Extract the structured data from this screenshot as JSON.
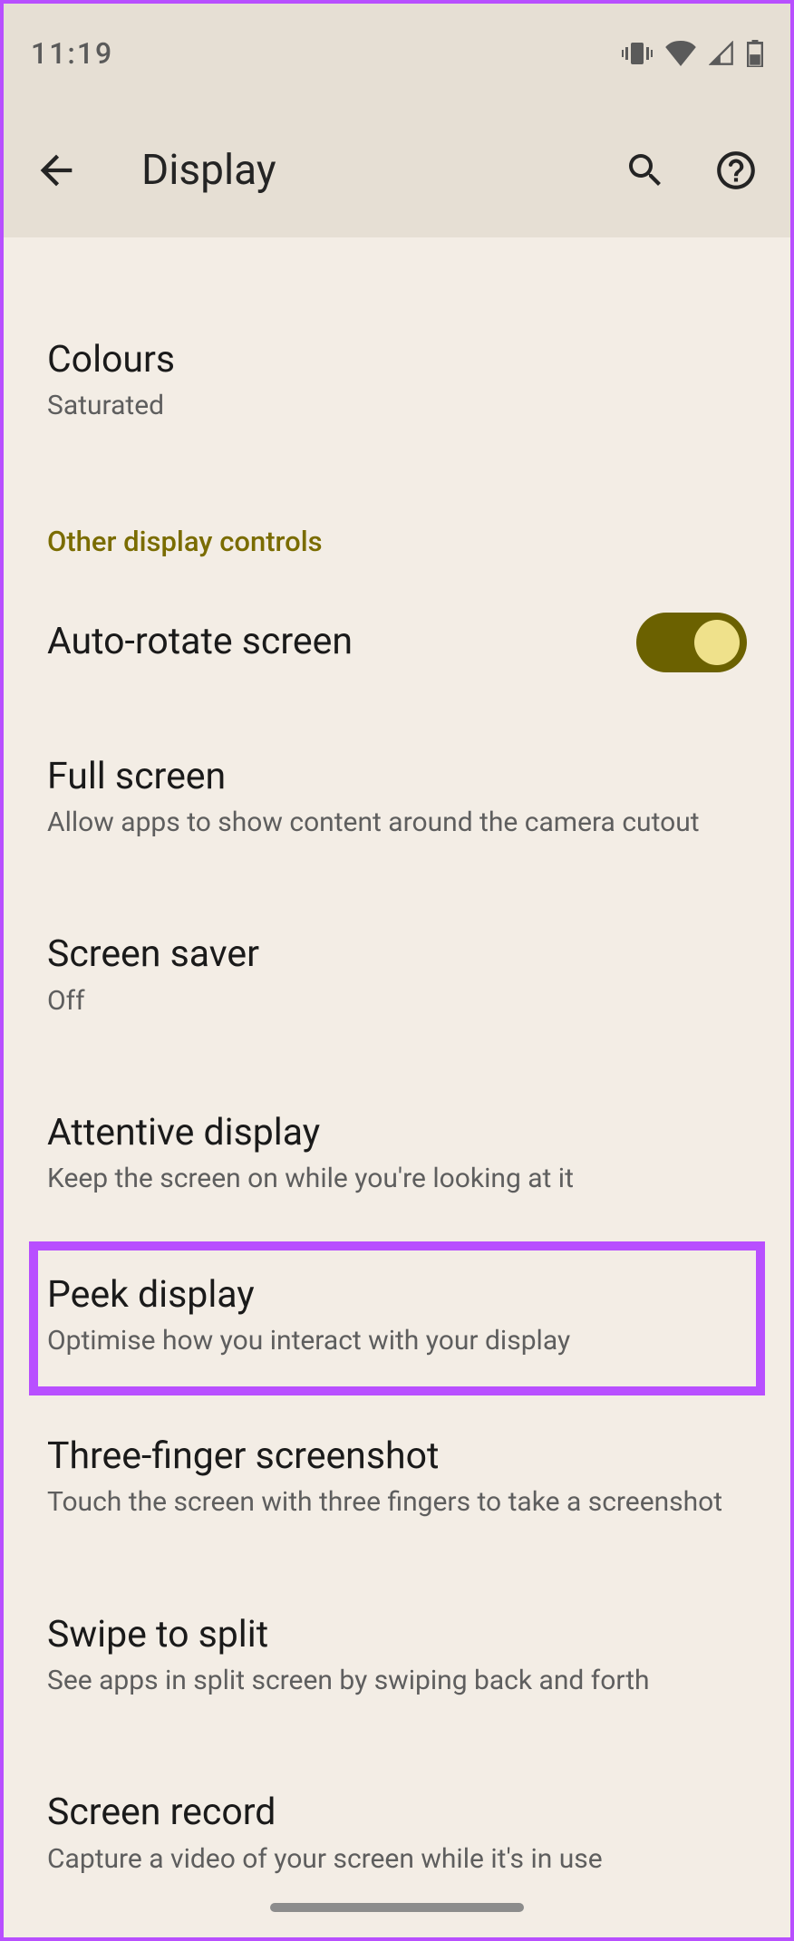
{
  "status": {
    "time": "11:19"
  },
  "appbar": {
    "title": "Display"
  },
  "section_header": "Other display controls",
  "settings": {
    "colours": {
      "title": "Colours",
      "subtitle": "Saturated"
    },
    "auto_rotate": {
      "title": "Auto-rotate screen",
      "enabled": true
    },
    "full_screen": {
      "title": "Full screen",
      "subtitle": "Allow apps to show content around the camera cutout"
    },
    "screen_saver": {
      "title": "Screen saver",
      "subtitle": "Off"
    },
    "attentive": {
      "title": "Attentive display",
      "subtitle": "Keep the screen on while you're looking at it"
    },
    "peek": {
      "title": "Peek display",
      "subtitle": "Optimise how you interact with your display"
    },
    "three_finger": {
      "title": "Three-finger screenshot",
      "subtitle": "Touch the screen with three fingers to take a screenshot"
    },
    "swipe_split": {
      "title": "Swipe to split",
      "subtitle": "See apps in split screen by swiping back and forth"
    },
    "screen_record": {
      "title": "Screen record",
      "subtitle": "Capture a video of your screen while it's in use"
    }
  }
}
